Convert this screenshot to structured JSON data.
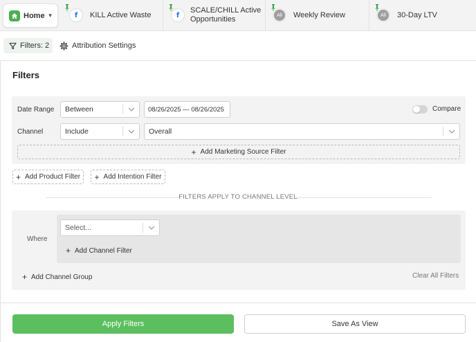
{
  "tabs": {
    "home": {
      "label": "Home"
    },
    "items": [
      {
        "label_line1": "KILL Active Waste",
        "label_line2": "",
        "icon": "facebook-icon",
        "badge_text": "f"
      },
      {
        "label_line1": "SCALE/CHILL Active",
        "label_line2": "Opportunities",
        "icon": "facebook-icon",
        "badge_text": "f"
      },
      {
        "label_line1": "Weekly Review",
        "label_line2": "",
        "icon": "all-channels-icon",
        "badge_text": "All"
      },
      {
        "label_line1": "30-Day LTV",
        "label_line2": "",
        "icon": "all-channels-icon",
        "badge_text": "All"
      }
    ]
  },
  "toolbar": {
    "filters_label": "Filters: 2",
    "attribution_label": "Attribution Settings"
  },
  "panel": {
    "title": "Filters",
    "date_range": {
      "label": "Date Range",
      "operator": "Between",
      "value": "08/26/2025 — 08/26/2025",
      "compare_label": "Compare",
      "compare_on": false
    },
    "channel": {
      "label": "Channel",
      "operator": "Include",
      "value": "Overall"
    },
    "add_marketing_source": "Add Marketing Source Filter",
    "add_product": "Add Product Filter",
    "add_intention": "Add Intention Filter",
    "divider_text": "FILTERS APPLY TO CHANNEL LEVEL",
    "channel_group": {
      "where_label": "Where",
      "select_placeholder": "Select...",
      "add_channel_filter": "Add Channel Filter",
      "add_channel_group": "Add Channel Group",
      "clear_all": "Clear All Filters"
    }
  },
  "footer": {
    "apply_label": "Apply Filters",
    "save_label": "Save As View"
  },
  "colors": {
    "accent_green": "#5cbf5f",
    "home_icon_green": "#4caf50",
    "facebook_blue": "#1877f2"
  }
}
